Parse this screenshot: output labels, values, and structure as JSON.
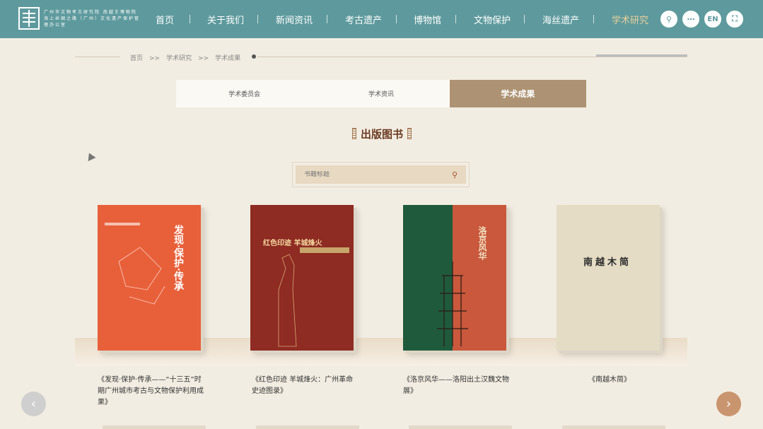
{
  "header": {
    "logo_text": "广州市文物考古研究院 南越王博物院 海上丝绸之路（广州）文化遗产保护管理办公室",
    "nav": [
      "首页",
      "关于我们",
      "新闻资讯",
      "考古遗产",
      "博物馆",
      "文物保护",
      "海丝遗产",
      "学术研究"
    ],
    "active_nav": "学术研究",
    "lang_label": "EN"
  },
  "breadcrumb": {
    "text": "首页　>>　学术研究　>>　学术成果"
  },
  "tabs": [
    "学术委员会",
    "学术资讯",
    "学术成果"
  ],
  "active_tab": "学术成果",
  "section_title": "出版图书",
  "search": {
    "placeholder": "书籍标题"
  },
  "books": [
    {
      "cover_title": "发现·保护·传承",
      "caption": "《发现·保护·传承——“十三五”时期广州城市考古与文物保护利用成果》",
      "cover_color": "#e8603a"
    },
    {
      "cover_title": "红色印迹 羊城烽火",
      "caption": "《红色印迹 羊城烽火：广州革命史迹图录》",
      "cover_color": "#8e2b22"
    },
    {
      "cover_title": "洛京风华",
      "caption": "《洛京风华——洛阳出土汉魏文物展》",
      "cover_color": "#c9583c"
    },
    {
      "cover_title": "南越木简",
      "caption": "《南越木简》",
      "cover_color": "#e4dcc4"
    }
  ],
  "colors": {
    "header_bg": "#5e9a9d",
    "active_tab_bg": "#ad9273",
    "page_bg": "#f2ede2"
  }
}
